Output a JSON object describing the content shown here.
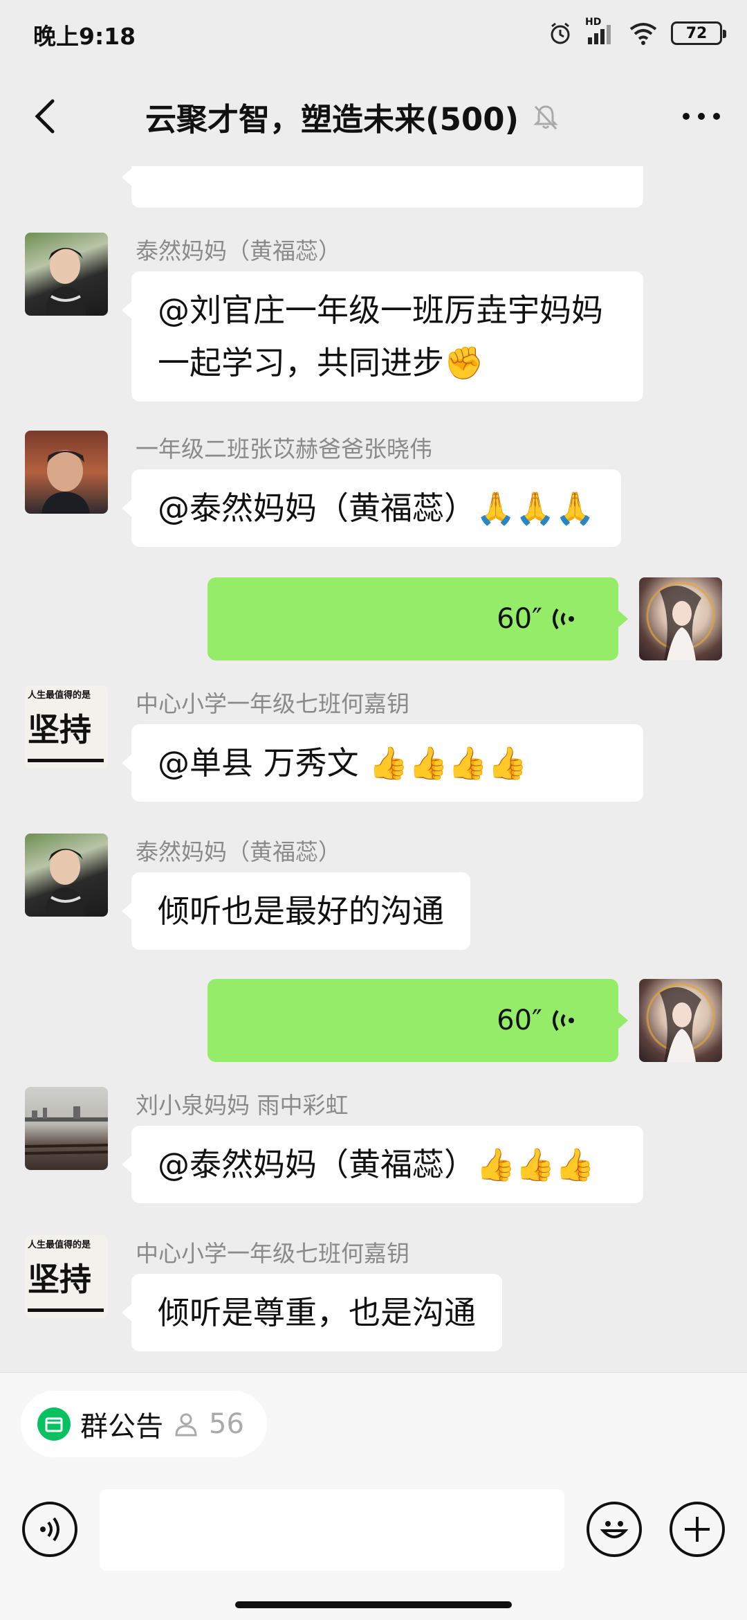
{
  "status_bar": {
    "time": "晚上9:18",
    "network": "HD",
    "battery": "72"
  },
  "header": {
    "title": "云聚才智，塑造未来(500)"
  },
  "messages": [
    {
      "sender": "泰然妈妈（黄福蕊）",
      "text": "@刘官庄一年级一班厉垚宇妈妈 一起学习，共同进步✊"
    },
    {
      "sender": "一年级二班张苡赫爸爸张晓伟",
      "text": "@泰然妈妈（黄福蕊）🙏🙏🙏"
    },
    {
      "voice": "60″"
    },
    {
      "sender": "中心小学一年级七班何嘉钥",
      "text": "@单县 万秀文 👍👍👍👍"
    },
    {
      "sender": "泰然妈妈（黄福蕊）",
      "text": "倾听也是最好的沟通"
    },
    {
      "voice": "60″"
    },
    {
      "sender": "刘小泉妈妈 雨中彩虹",
      "text": "@泰然妈妈（黄福蕊）👍👍👍"
    },
    {
      "sender": "中心小学一年级七班何嘉钥",
      "text": "倾听是尊重，也是沟通"
    }
  ],
  "avatar_text": {
    "line1": "人生最值得的是",
    "line2": "坚持"
  },
  "bottom": {
    "notice_label": "群公告",
    "notice_count": "56"
  },
  "colors": {
    "voice_bubble": "#95ec69",
    "accent_green": "#07c160"
  }
}
